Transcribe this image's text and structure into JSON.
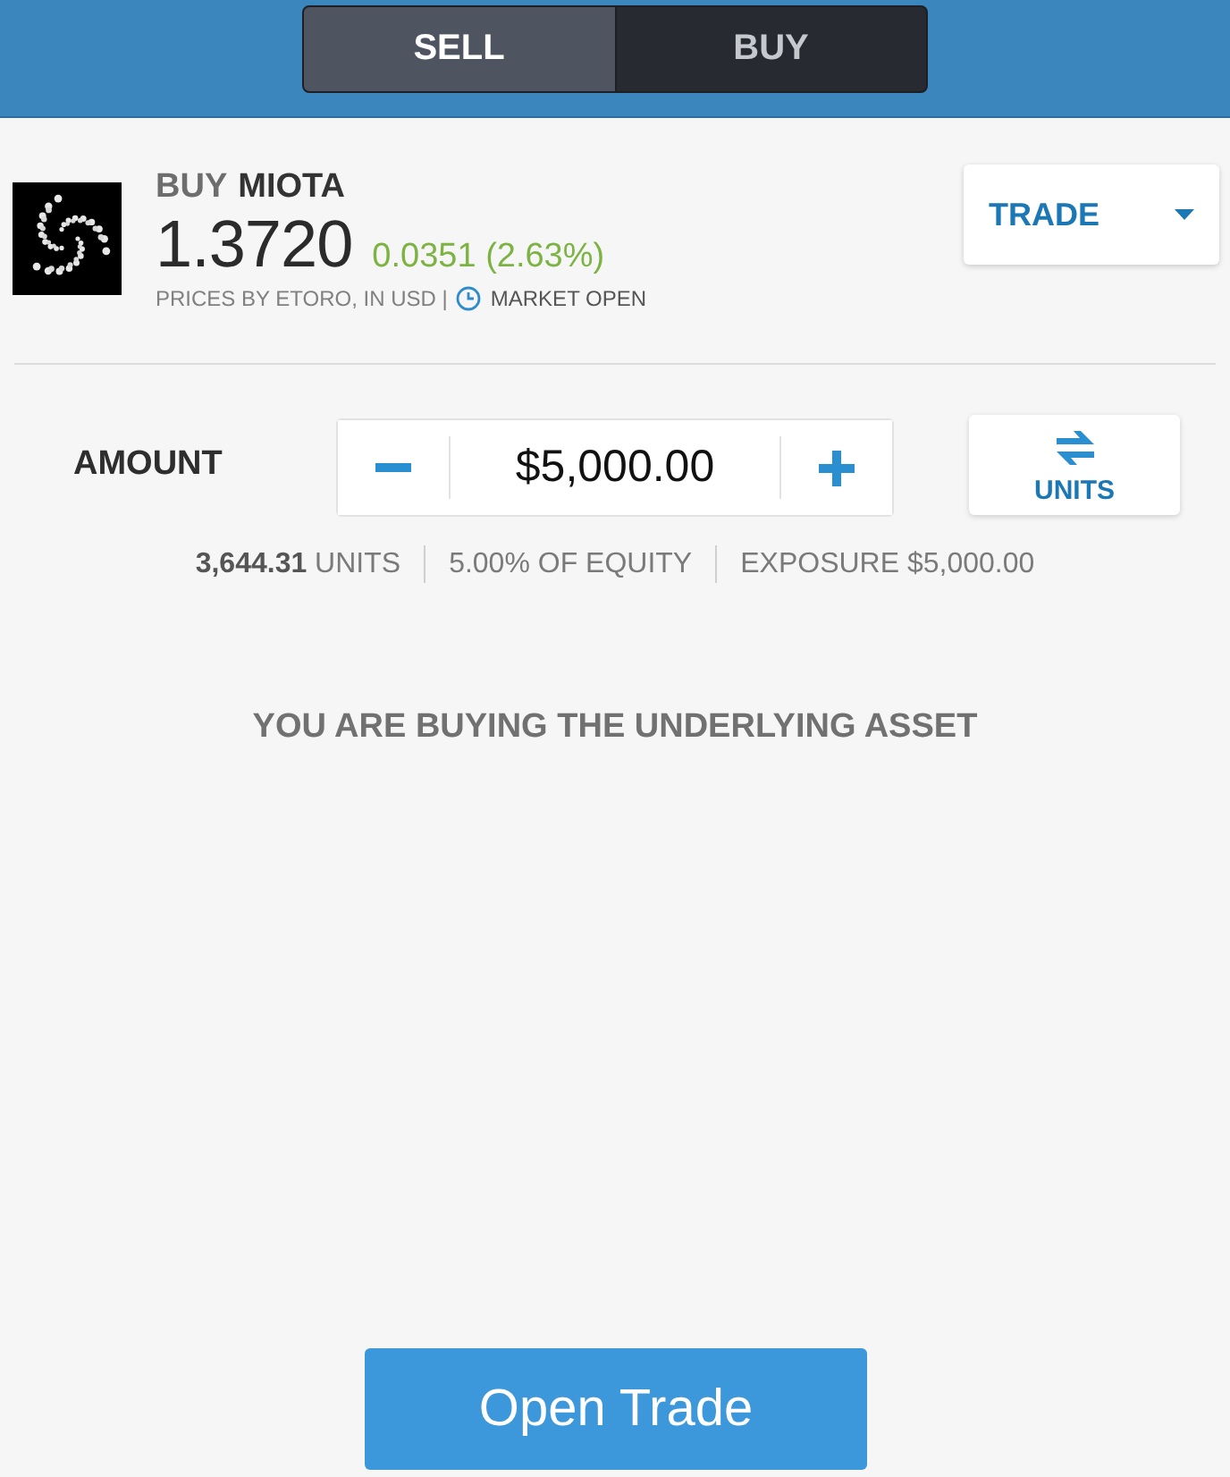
{
  "tabs": [
    {
      "label": "SELL",
      "selected": false
    },
    {
      "label": "BUY",
      "selected": true
    }
  ],
  "instrument": {
    "action": "BUY",
    "symbol": "MIOTA",
    "price": "1.3720",
    "change": "0.0351 (2.63%)",
    "source": "PRICES BY ETORO, IN USD |",
    "market_status": "MARKET OPEN"
  },
  "order_type": {
    "label": "TRADE"
  },
  "amount": {
    "label": "AMOUNT",
    "value": "$5,000.00",
    "toggle_label": "UNITS"
  },
  "summary": [
    "**3,644.31** UNITS",
    "5.00% OF EQUITY",
    "EXPOSURE $5,000.00"
  ],
  "notice": "YOU ARE BUYING THE UNDERLYING ASSET",
  "submit": {
    "label": "Open Trade"
  }
}
